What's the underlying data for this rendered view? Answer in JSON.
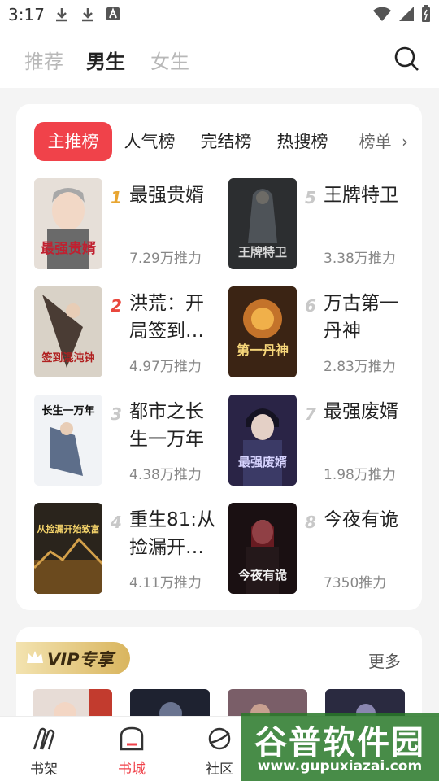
{
  "status": {
    "time": "3:17"
  },
  "top_tabs": [
    "推荐",
    "男生",
    "女生"
  ],
  "rank_tabs": [
    "主推榜",
    "人气榜",
    "完结榜",
    "热搜榜"
  ],
  "rank_more": "榜单",
  "books": [
    {
      "rank": "1",
      "title": "最强贵婿",
      "heat": "7.29万推力",
      "cover_text": "最强贵婿"
    },
    {
      "rank": "2",
      "title": "洪荒：开局签到…",
      "heat": "4.97万推力",
      "cover_text": "签到混沌钟"
    },
    {
      "rank": "3",
      "title": "都市之长生一万年",
      "heat": "4.38万推力",
      "cover_text": "长生一万年"
    },
    {
      "rank": "4",
      "title": "重生81:从捡漏开…",
      "heat": "4.11万推力",
      "cover_text": "从捡漏开始致富"
    },
    {
      "rank": "5",
      "title": "王牌特卫",
      "heat": "3.38万推力",
      "cover_text": "王牌特卫"
    },
    {
      "rank": "6",
      "title": "万古第一丹神",
      "heat": "2.83万推力",
      "cover_text": "第一丹神"
    },
    {
      "rank": "7",
      "title": "最强废婿",
      "heat": "1.98万推力",
      "cover_text": "最强废婿"
    },
    {
      "rank": "8",
      "title": "今夜有诡",
      "heat": "7350推力",
      "cover_text": "今夜有诡"
    }
  ],
  "vip": {
    "badge": "VIP专享",
    "more": "更多"
  },
  "nav": [
    "书架",
    "书城",
    "社区"
  ],
  "watermark": {
    "title": "谷普软件园",
    "url": "www.gupuxiazai.com"
  },
  "colors": {
    "accent": "#f0424a",
    "vip_gold": "#d9b55e",
    "watermark": "#2a7a2a"
  }
}
